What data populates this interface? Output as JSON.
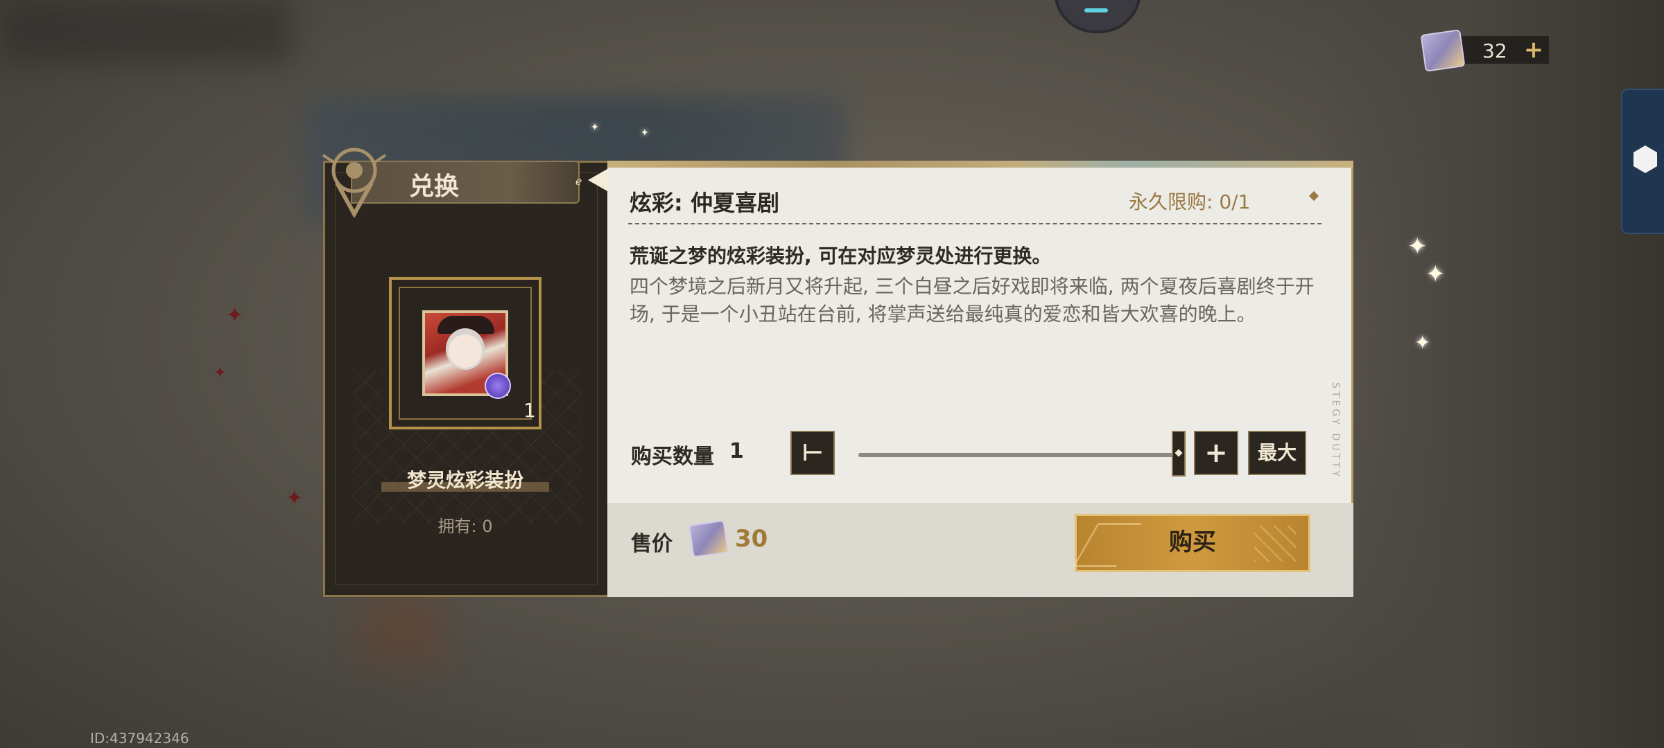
{
  "currency": {
    "amount": "32",
    "icon": "dream-ticket-icon",
    "add_icon": "plus-icon"
  },
  "dialog": {
    "title": "兑换",
    "item": {
      "count": "1",
      "name": "梦灵炫彩装扮",
      "owned": "拥有: 0"
    },
    "product_title": "炫彩: 仲夏喜剧",
    "limit": "永久限购: 0/1",
    "description_main": "荒诞之梦的炫彩装扮, 可在对应梦灵处进行更换。",
    "description_text": "四个梦境之后新月又将升起, 三个白昼之后好戏即将来临, 两个夏夜后喜剧终于开场, 于是一个小丑站在台前, 将掌声送给最纯真的爱恋和皆大欢喜的晚上。",
    "quantity_label": "购买数量",
    "quantity_value": "1",
    "quantity_fraction": 1.0,
    "max_label": "最大",
    "price_label": "售价",
    "price_value": "30",
    "buy_label": "购买"
  },
  "uid": "ID:437942346",
  "colors": {
    "accent_gold": "#cf9a3f",
    "panel_dark": "#2b2520",
    "panel_light": "#ecebe6",
    "price_gold": "#a07a38"
  }
}
